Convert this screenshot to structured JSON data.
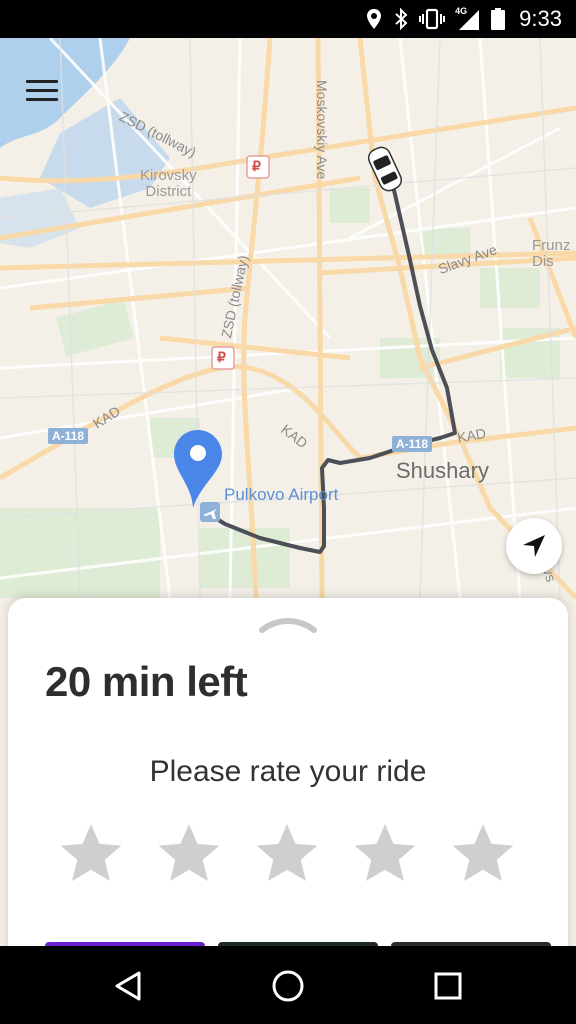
{
  "status_bar": {
    "time": "9:33",
    "network": "4G",
    "icons": [
      "location-icon",
      "bluetooth-icon",
      "vibrate-icon",
      "signal-icon",
      "battery-icon"
    ]
  },
  "map": {
    "labels": {
      "district_line1": "Kirovsky",
      "district_line2": "District",
      "zsd_tollway_top": "ZSD (tollway)",
      "zsd_tollway_vertical": "ZSD (tollway)",
      "moskovskiy_ave": "Moskovskiy Ave",
      "slavy_ave": "Slavy Ave",
      "frunz_line1": "Frunz",
      "frunz_line2": "Dis",
      "kad_left": "KAD",
      "kad_middle": "KAD",
      "kad_right": "KAD",
      "shushary": "Shushary",
      "airport": "Pulkovo Airport",
      "a118_left": "A-118",
      "a118_right": "A-118",
      "ruble_1": "₽",
      "ruble_2": "₽",
      "cut_right": "ovs"
    },
    "route_color": "#4d4f57",
    "pin_color": "#4a86e8"
  },
  "sheet": {
    "time_left": "20 min left",
    "rate_prompt": "Please rate your ride",
    "star_count": 5,
    "star_color": "#cfcfcf",
    "buttons": [
      {
        "name": "action-button-1",
        "color": "#6a1fd0"
      },
      {
        "name": "action-button-2",
        "color": "#1f2a22"
      },
      {
        "name": "action-button-3",
        "color": "#2a2a2a"
      }
    ]
  },
  "nav_bar": {
    "buttons": [
      "back-icon",
      "home-icon",
      "recents-icon"
    ]
  }
}
